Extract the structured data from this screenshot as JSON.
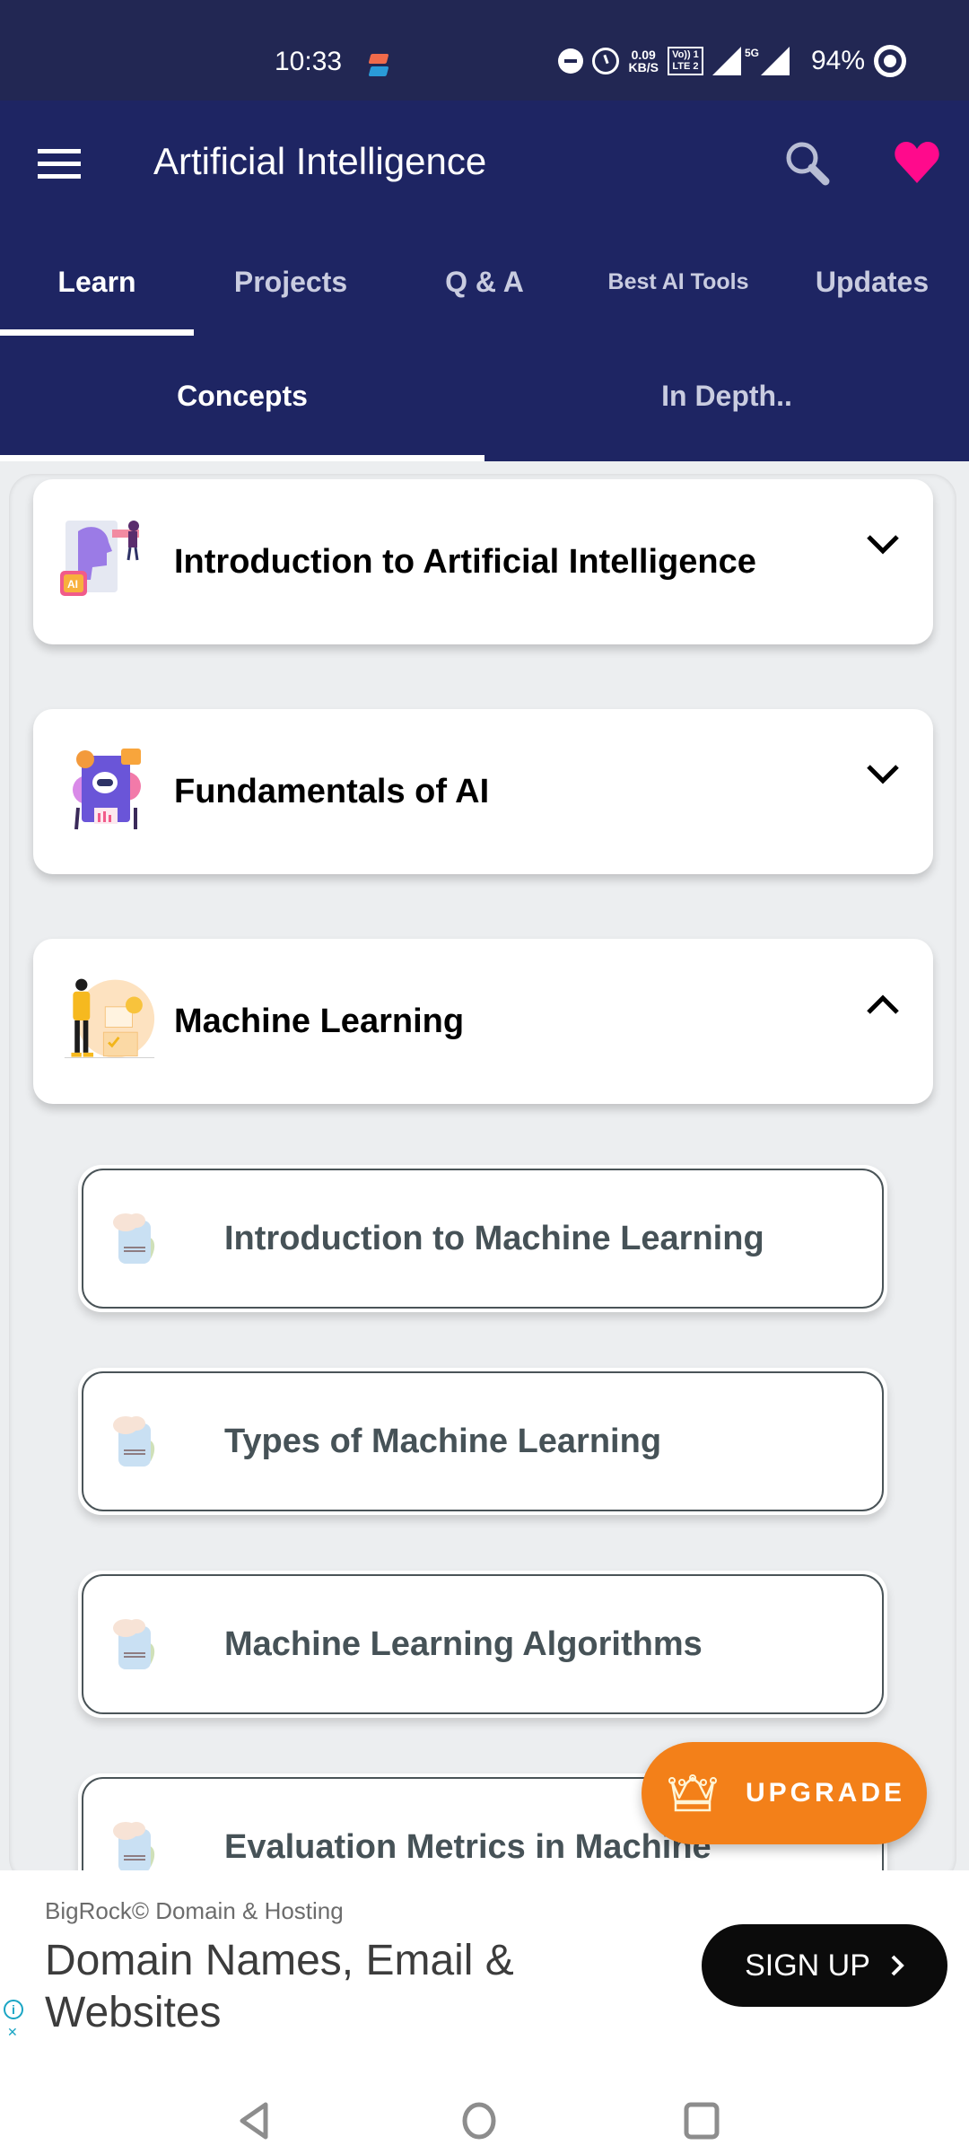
{
  "status_bar": {
    "time": "10:33",
    "net_speed_value": "0.09",
    "net_speed_unit": "KB/S",
    "volte_top": "Vo)) 1",
    "volte_bottom": "LTE 2",
    "network_type": "5G",
    "battery": "94%"
  },
  "app_bar": {
    "title": "Artificial Intelligence",
    "icons": [
      "menu-icon",
      "search-icon",
      "heart-icon"
    ],
    "heart_color": "#ff0a8c"
  },
  "main_tabs": [
    {
      "label": "Learn",
      "active": true
    },
    {
      "label": "Projects",
      "active": false
    },
    {
      "label": "Q & A",
      "active": false
    },
    {
      "label": "Best AI Tools",
      "active": false
    },
    {
      "label": "Updates",
      "active": false
    }
  ],
  "sub_tabs": [
    {
      "label": "Concepts",
      "active": true
    },
    {
      "label": "In Depth..",
      "active": false
    }
  ],
  "topics": [
    {
      "title": "Introduction to Artificial Intelligence",
      "expanded": false,
      "icon": "ai-head-illustration"
    },
    {
      "title": "Fundamentals of AI",
      "expanded": false,
      "icon": "robot-illustration"
    },
    {
      "title": "Machine Learning",
      "expanded": true,
      "icon": "ml-person-illustration"
    }
  ],
  "subtopics": [
    {
      "title": "Introduction to Machine Learning",
      "icon": "document-icon"
    },
    {
      "title": "Types of Machine Learning",
      "icon": "document-icon"
    },
    {
      "title": "Machine Learning Algorithms",
      "icon": "document-icon"
    },
    {
      "title": "Evaluation Metrics in Machine",
      "icon": "document-icon"
    }
  ],
  "upgrade": {
    "label": "UPGRADE",
    "color": "#f38019"
  },
  "ad": {
    "brand": "BigRock© Domain & Hosting",
    "headline": "Domain Names, Email & Websites",
    "cta": "SIGN UP",
    "info_label": "i"
  },
  "colors": {
    "header": "#1e2563",
    "status_bar": "#222753",
    "content_bg": "#eceef0",
    "subtopic_text": "#465257"
  }
}
